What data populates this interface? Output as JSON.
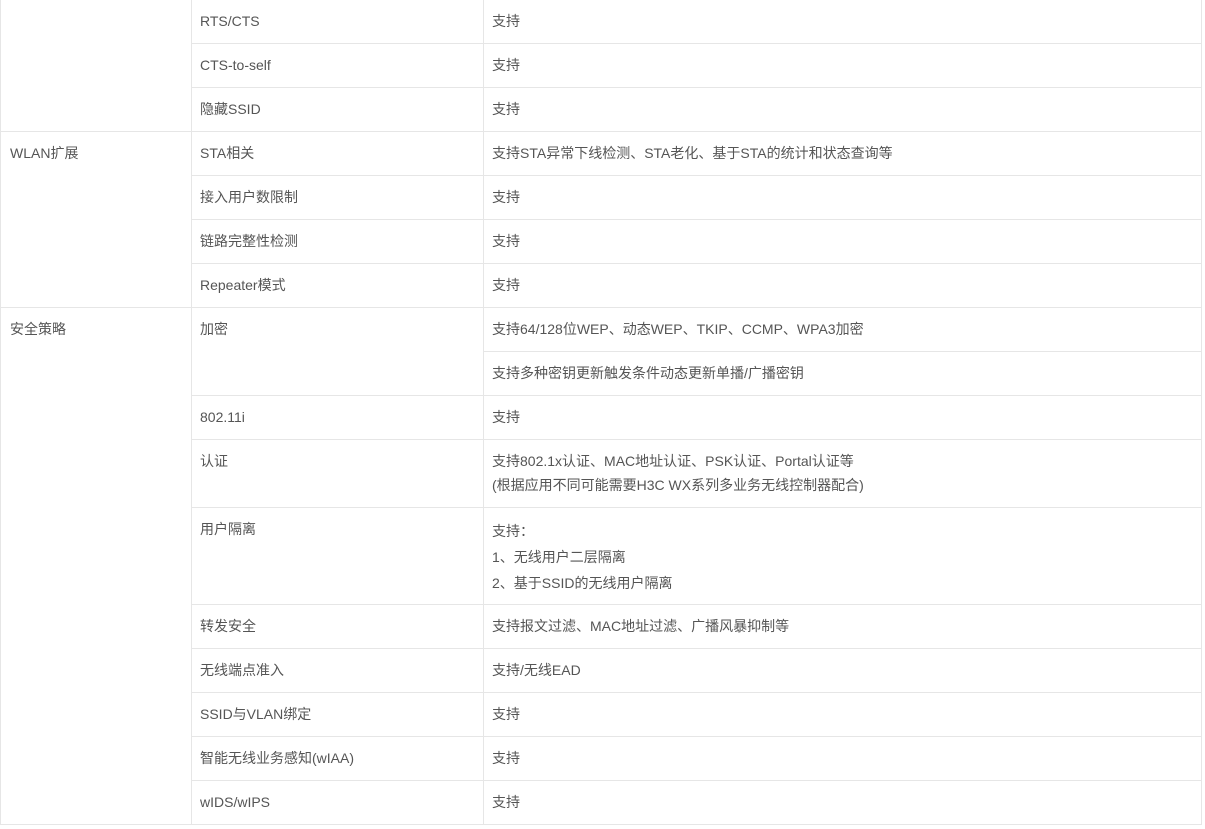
{
  "rows": [
    {
      "category": "",
      "feature": "RTS/CTS",
      "value": [
        "支持"
      ]
    },
    {
      "feature": "CTS-to-self",
      "value": [
        "支持"
      ]
    },
    {
      "feature": "隐藏SSID",
      "value": [
        "支持"
      ]
    },
    {
      "category": "WLAN扩展",
      "feature": "STA相关",
      "value": [
        "支持STA异常下线检测、STA老化、基于STA的统计和状态查询等"
      ]
    },
    {
      "feature": "接入用户数限制",
      "value": [
        "支持"
      ]
    },
    {
      "feature": "链路完整性检测",
      "value": [
        "支持"
      ]
    },
    {
      "feature": "Repeater模式",
      "value": [
        "支持"
      ]
    },
    {
      "category": "安全策略",
      "feature": "加密",
      "value": [
        "支持64/128位WEP、动态WEP、TKIP、CCMP、WPA3加密"
      ]
    },
    {
      "value": [
        "支持多种密钥更新触发条件动态更新单播/广播密钥"
      ]
    },
    {
      "feature": "802.11i",
      "value": [
        "支持"
      ]
    },
    {
      "feature": "认证",
      "value": [
        "支持802.1x认证、MAC地址认证、PSK认证、Portal认证等",
        "(根据应用不同可能需要H3C WX系列多业务无线控制器配合)"
      ]
    },
    {
      "feature": "用户隔离",
      "value": [
        "支持：",
        "1、无线用户二层隔离",
        "2、基于SSID的无线用户隔离"
      ]
    },
    {
      "feature": "转发安全",
      "value": [
        "支持报文过滤、MAC地址过滤、广播风暴抑制等"
      ]
    },
    {
      "feature": "无线端点准入",
      "value": [
        "支持/无线EAD"
      ]
    },
    {
      "feature": "SSID与VLAN绑定",
      "value": [
        "支持"
      ]
    },
    {
      "feature": "智能无线业务感知(wIAA)",
      "value": [
        "支持"
      ]
    },
    {
      "feature": "wIDS/wIPS",
      "value": [
        "支持"
      ]
    }
  ]
}
